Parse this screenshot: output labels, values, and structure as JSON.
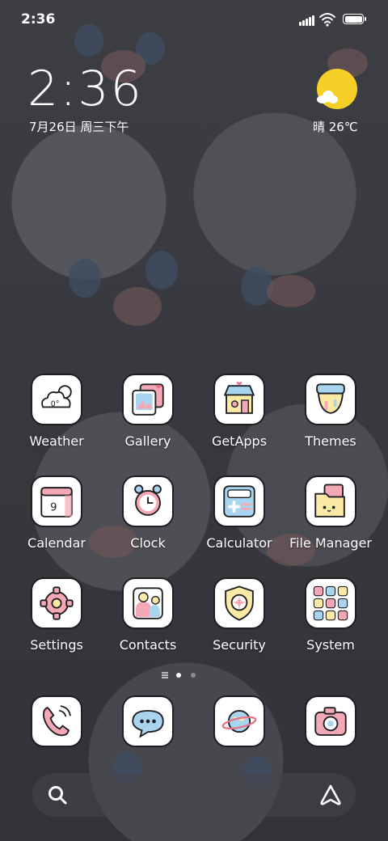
{
  "status_bar": {
    "time": "2:36",
    "icons": [
      "signal-icon",
      "wifi-icon",
      "battery-icon"
    ]
  },
  "clock_widget": {
    "time": "2:36",
    "date": "7月26日 周三下午"
  },
  "weather_widget": {
    "summary": "晴 26℃",
    "icon": "sunny-cloud-icon"
  },
  "apps": [
    {
      "label": "Weather",
      "icon": "weather-icon"
    },
    {
      "label": "Gallery",
      "icon": "gallery-icon"
    },
    {
      "label": "GetApps",
      "icon": "getapps-icon"
    },
    {
      "label": "Themes",
      "icon": "themes-icon"
    },
    {
      "label": "Calendar",
      "icon": "calendar-icon"
    },
    {
      "label": "Clock",
      "icon": "alarm-clock-icon"
    },
    {
      "label": "Calculator",
      "icon": "calculator-icon"
    },
    {
      "label": "File Manager",
      "icon": "file-manager-icon"
    },
    {
      "label": "Settings",
      "icon": "gear-icon"
    },
    {
      "label": "Contacts",
      "icon": "contacts-icon"
    },
    {
      "label": "Security",
      "icon": "shield-icon"
    },
    {
      "label": "System",
      "icon": "folder-icon"
    }
  ],
  "weather_app_icon_text": "0°",
  "calendar_app_icon_text": "9",
  "dock": [
    {
      "icon": "phone-icon"
    },
    {
      "icon": "messages-icon"
    },
    {
      "icon": "browser-planet-icon"
    },
    {
      "icon": "camera-icon"
    }
  ],
  "page_indicator": {
    "pages": 2,
    "current": 1
  },
  "search_bar": {
    "left_icon": "search-icon",
    "right_icon": "assistant-icon"
  },
  "colors": {
    "accent_sun": "#f6d027",
    "icon_background": "#ffffff",
    "icon_outline": "#1f1f22",
    "pastel_pink": "#f4a7b4",
    "pastel_blue": "#a9d4f0",
    "pastel_yellow": "#fbe9a6"
  }
}
